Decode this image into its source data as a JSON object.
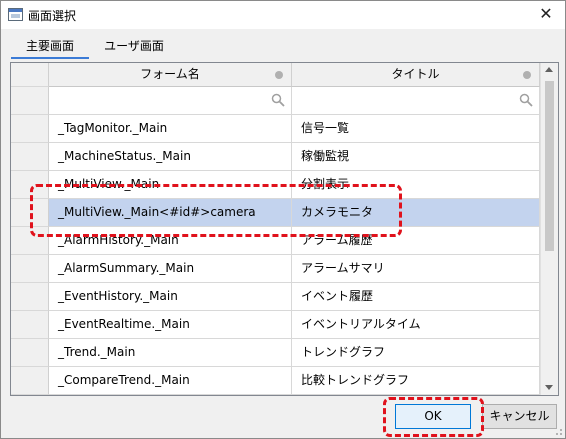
{
  "window": {
    "title": "画面選択",
    "close_label": "✕"
  },
  "tabs": [
    {
      "label": "主要画面",
      "active": true
    },
    {
      "label": "ユーザ画面",
      "active": false
    }
  ],
  "grid": {
    "columns": [
      {
        "label": "フォーム名"
      },
      {
        "label": "タイトル"
      }
    ],
    "rows": [
      {
        "form": "_TagMonitor._Main",
        "title": "信号一覧",
        "selected": false
      },
      {
        "form": "_MachineStatus._Main",
        "title": "稼働監視",
        "selected": false
      },
      {
        "form": "_MultiView._Main",
        "title": "分割表示",
        "selected": false
      },
      {
        "form": "_MultiView._Main<#id#>camera",
        "title": "カメラモニタ",
        "selected": true
      },
      {
        "form": "_AlarmHistory._Main",
        "title": "アラーム履歴",
        "selected": false
      },
      {
        "form": "_AlarmSummary._Main",
        "title": "アラームサマリ",
        "selected": false
      },
      {
        "form": "_EventHistory._Main",
        "title": "イベント履歴",
        "selected": false
      },
      {
        "form": "_EventRealtime._Main",
        "title": "イベントリアルタイム",
        "selected": false
      },
      {
        "form": "_Trend._Main",
        "title": "トレンドグラフ",
        "selected": false
      },
      {
        "form": "_CompareTrend._Main",
        "title": "比較トレンドグラフ",
        "selected": false
      }
    ]
  },
  "buttons": {
    "ok": "OK",
    "cancel": "キャンセル"
  },
  "colors": {
    "selected_row": "#c3d3ee",
    "tab_accent": "#3b7bd6",
    "annotation": "#e0121c"
  }
}
